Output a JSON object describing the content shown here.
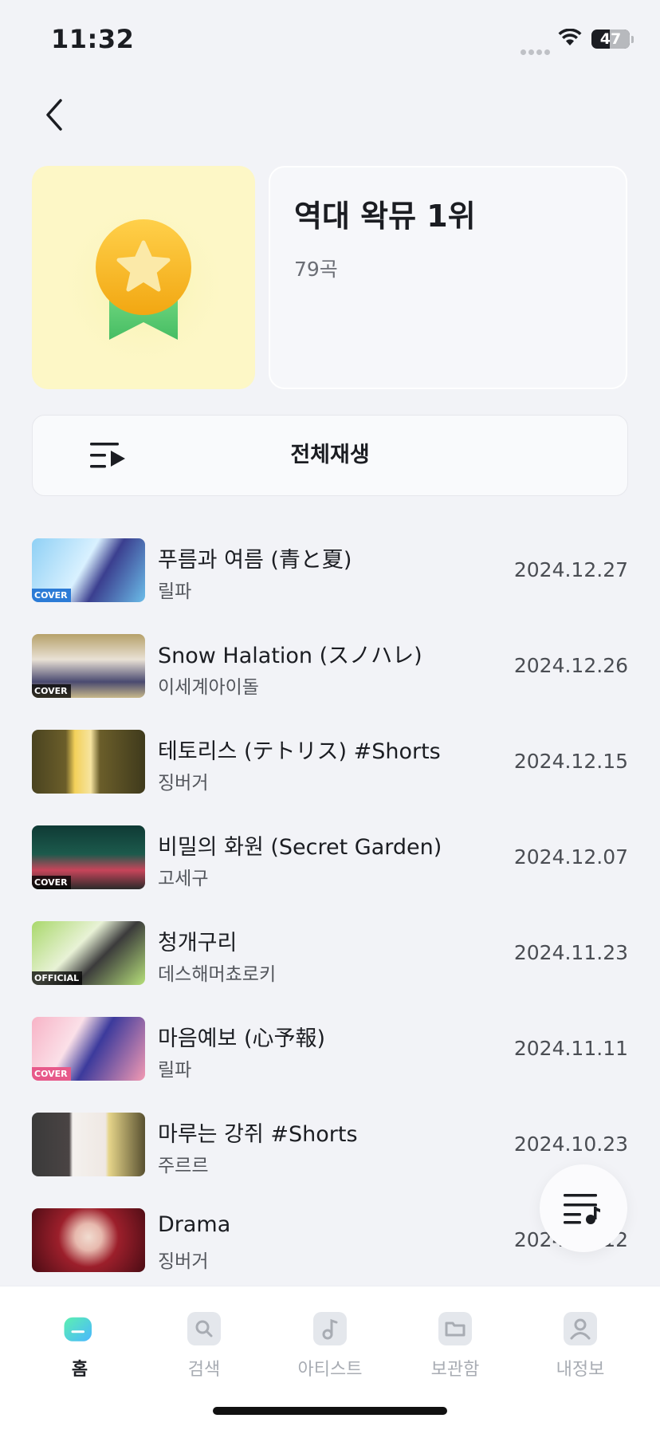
{
  "status_bar": {
    "time": "11:32",
    "battery": "47",
    "battery_level": 0.47
  },
  "playlist": {
    "title": "역대 왁뮤 1위",
    "count": "79곡",
    "play_all_label": "전체재생"
  },
  "songs": [
    {
      "title": "푸름과 여름 (青と夏)",
      "artist": "릴파",
      "date": "2024.12.27",
      "badge": "COVER"
    },
    {
      "title": "Snow Halation (スノハレ)",
      "artist": "이세계아이돌",
      "date": "2024.12.26",
      "badge": "COVER"
    },
    {
      "title": "테토리스 (テトリス) #Shorts",
      "artist": "징버거",
      "date": "2024.12.15",
      "badge": ""
    },
    {
      "title": "비밀의 화원 (Secret Garden)",
      "artist": "고세구",
      "date": "2024.12.07",
      "badge": "COVER"
    },
    {
      "title": "청개구리",
      "artist": "데스해머쵸로키",
      "date": "2024.11.23",
      "badge": "OFFICIAL"
    },
    {
      "title": "마음예보 (心予報)",
      "artist": "릴파",
      "date": "2024.11.11",
      "badge": "COVER"
    },
    {
      "title": "마루는 강쥐 #Shorts",
      "artist": "주르르",
      "date": "2024.10.23",
      "badge": ""
    },
    {
      "title": "Drama",
      "artist": "징버거",
      "date": "2024.10.12",
      "badge": ""
    }
  ],
  "tabs": [
    {
      "label": "홈",
      "icon": "home-icon",
      "active": true
    },
    {
      "label": "검색",
      "icon": "search-icon",
      "active": false
    },
    {
      "label": "아티스트",
      "icon": "music-note-icon",
      "active": false
    },
    {
      "label": "보관함",
      "icon": "folder-icon",
      "active": false
    },
    {
      "label": "내정보",
      "icon": "person-icon",
      "active": false
    }
  ],
  "colors": {
    "background": "#f2f3f7",
    "accent": "#3ee0c2",
    "cover_bg": "#fdf7c6",
    "medal": "#f6b21a",
    "ribbon": "#57c76a"
  }
}
